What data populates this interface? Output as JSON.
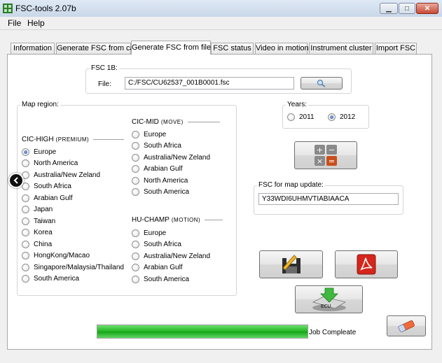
{
  "window": {
    "title": "FSC-tools 2.07b",
    "minimize_glyph": "▁",
    "maximize_glyph": "□",
    "close_glyph": "✕"
  },
  "menu": [
    "File",
    "Help"
  ],
  "tabs": [
    {
      "label": "Information",
      "active": false
    },
    {
      "label": "Generate FSC from car",
      "active": false
    },
    {
      "label": "Generate FSC from file",
      "active": true
    },
    {
      "label": "FSC status",
      "active": false
    },
    {
      "label": "Video in motion",
      "active": false
    },
    {
      "label": "Instrument cluster",
      "active": false
    },
    {
      "label": "Import FSC",
      "active": false
    }
  ],
  "fsc1b": {
    "group_title": "FSC 1B:",
    "file_label": "File:",
    "file_value": "C:/FSC/CU62537_001B0001.fsc"
  },
  "map_region": {
    "group_title": "Map region:",
    "cic_high": {
      "title": "CIC-HIGH",
      "tag": "(PREMIUM)",
      "options": [
        "Europe",
        "North America",
        "Australia/New Zeland",
        "South Africa",
        "Arabian Gulf",
        "Japan",
        "Taiwan",
        "Korea",
        "China",
        "HongKong/Macao",
        "Singapore/Malaysia/Thailand",
        "South America"
      ],
      "selected": 0
    },
    "cic_mid": {
      "title": "CIC-MID",
      "tag": "(MOVE)",
      "options": [
        "Europe",
        "South Africa",
        "Australia/New Zeland",
        "Arabian Gulf",
        "North America",
        "South America"
      ],
      "selected": -1
    },
    "hu_champ": {
      "title": "HU-CHAMP",
      "tag": "(MOTION)",
      "options": [
        "Europe",
        "South Africa",
        "Australia/New Zeland",
        "Arabian Gulf",
        "South America"
      ],
      "selected": -1
    }
  },
  "years": {
    "group_title": "Years:",
    "options": [
      "2011",
      "2012"
    ],
    "selected": 1
  },
  "fsc_update": {
    "group_title": "FSC for map update:",
    "value": "Y33WDI6UHMVTIABIAACA"
  },
  "ecu_label": "ECU",
  "status": {
    "progress": 1.0,
    "text": "Job Compleate"
  }
}
